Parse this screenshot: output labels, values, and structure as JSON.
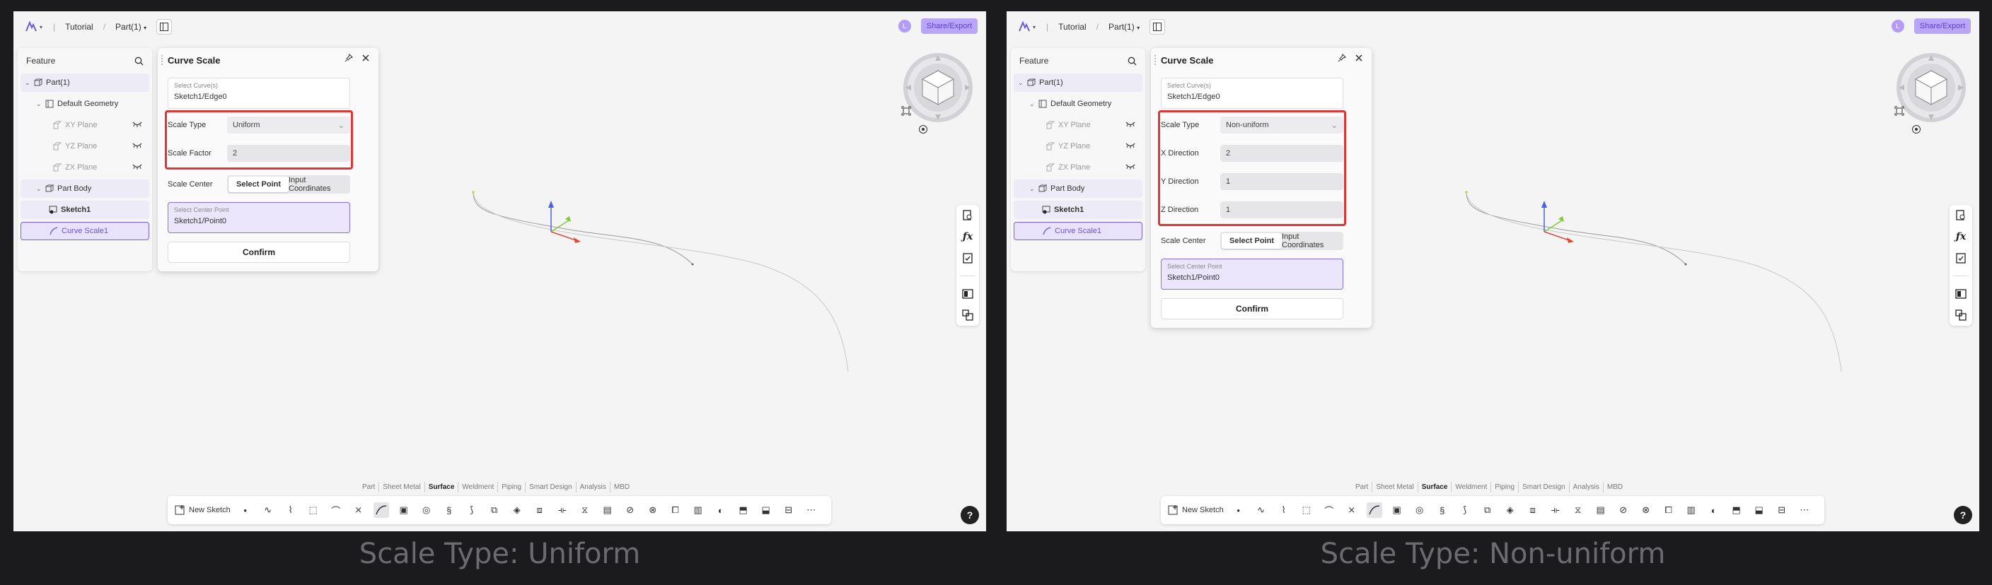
{
  "panels": [
    {
      "caption": "Scale Type: Uniform",
      "topbar": {
        "crumb_tutorial": "Tutorial",
        "crumb_part": "Part(1)",
        "avatar_initial": "L",
        "share_label": "Share/Export"
      },
      "tree": {
        "title": "Feature",
        "items": [
          "Part(1)",
          "Default Geometry",
          "XY Plane",
          "YZ Plane",
          "ZX Plane",
          "Part Body",
          "Sketch1",
          "Curve Scale1"
        ]
      },
      "dialog": {
        "title": "Curve Scale",
        "select_curve_label": "Select Curve(s)",
        "select_curve_value": "Sketch1/Edge0",
        "rows": [
          {
            "label": "Scale Type",
            "value": "Uniform",
            "dropdown": true
          },
          {
            "label": "Scale Factor",
            "value": "2",
            "dropdown": false
          }
        ],
        "scale_center_label": "Scale Center",
        "seg_select_point": "Select Point",
        "seg_input_coords": "Input Coordinates",
        "center_label": "Select Center Point",
        "center_value": "Sketch1/Point0",
        "confirm": "Confirm"
      },
      "tabs": [
        "Part",
        "Sheet Metal",
        "Surface",
        "Weldment",
        "Piping",
        "Smart Design",
        "Analysis",
        "MBD"
      ],
      "active_tab": "Surface",
      "new_sketch": "New Sketch",
      "help": "?"
    },
    {
      "caption": "Scale Type: Non-uniform",
      "topbar": {
        "crumb_tutorial": "Tutorial",
        "crumb_part": "Part(1)",
        "avatar_initial": "L",
        "share_label": "Share/Export"
      },
      "tree": {
        "title": "Feature",
        "items": [
          "Part(1)",
          "Default Geometry",
          "XY Plane",
          "YZ Plane",
          "ZX Plane",
          "Part Body",
          "Sketch1",
          "Curve Scale1"
        ]
      },
      "dialog": {
        "title": "Curve Scale",
        "select_curve_label": "Select Curve(s)",
        "select_curve_value": "Sketch1/Edge0",
        "rows": [
          {
            "label": "Scale Type",
            "value": "Non-uniform",
            "dropdown": true
          },
          {
            "label": "X Direction",
            "value": "2",
            "dropdown": false
          },
          {
            "label": "Y Direction",
            "value": "1",
            "dropdown": false
          },
          {
            "label": "Z Direction",
            "value": "1",
            "dropdown": false
          }
        ],
        "scale_center_label": "Scale Center",
        "seg_select_point": "Select Point",
        "seg_input_coords": "Input Coordinates",
        "center_label": "Select Center Point",
        "center_value": "Sketch1/Point0",
        "confirm": "Confirm"
      },
      "tabs": [
        "Part",
        "Sheet Metal",
        "Surface",
        "Weldment",
        "Piping",
        "Smart Design",
        "Analysis",
        "MBD"
      ],
      "active_tab": "Surface",
      "new_sketch": "New Sketch",
      "help": "?"
    }
  ],
  "colors": {
    "accent": "#7b61e8",
    "highlight_box": "#e03535",
    "background": "#1b1b1d",
    "canvas": "#f4f4f5"
  }
}
